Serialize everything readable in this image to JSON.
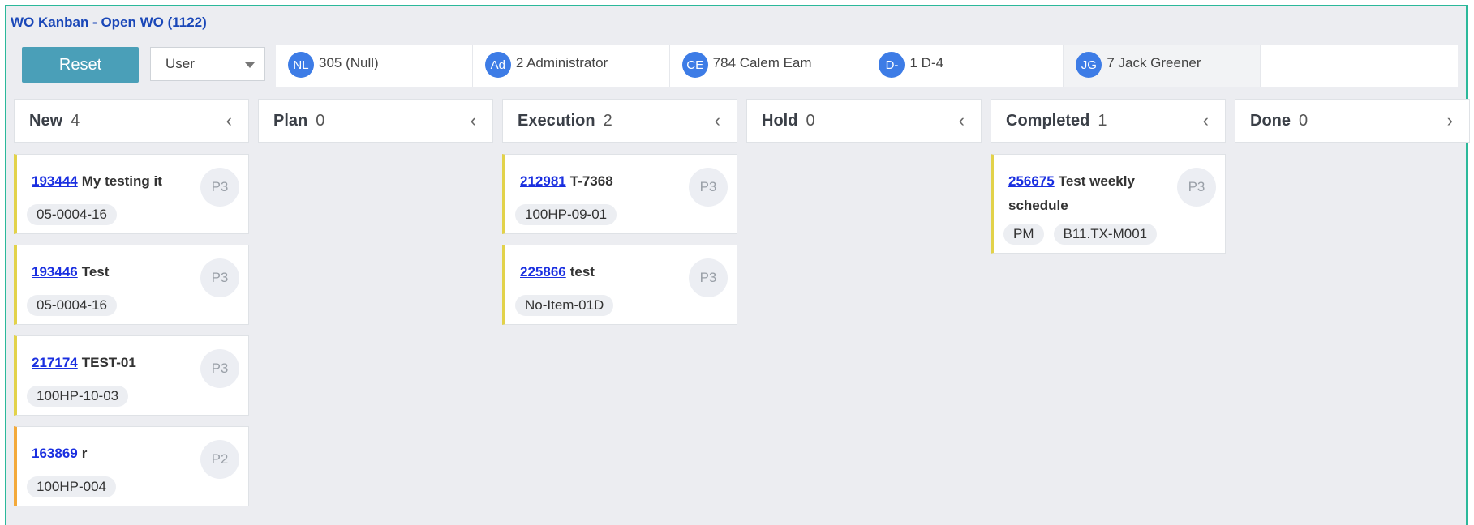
{
  "header": {
    "title": "WO Kanban - Open WO (1122)"
  },
  "toolbar": {
    "reset_label": "Reset",
    "user_select_value": "User"
  },
  "users": [
    {
      "initials": "NL",
      "label": "305 (Null)"
    },
    {
      "initials": "Ad",
      "label": "2 Administrator"
    },
    {
      "initials": "CE",
      "label": "784 Calem Eam"
    },
    {
      "initials": "D-",
      "label": "1 D-4"
    },
    {
      "initials": "JG",
      "label": "7 Jack Greener"
    }
  ],
  "columns": [
    {
      "name": "New",
      "count": "4",
      "chevron": "‹"
    },
    {
      "name": "Plan",
      "count": "0",
      "chevron": "‹"
    },
    {
      "name": "Execution",
      "count": "2",
      "chevron": "‹"
    },
    {
      "name": "Hold",
      "count": "0",
      "chevron": "‹"
    },
    {
      "name": "Completed",
      "count": "1",
      "chevron": "‹"
    },
    {
      "name": "Done",
      "count": "0",
      "chevron": "›"
    }
  ],
  "cards": {
    "new": [
      {
        "wo": "193444",
        "title": "My testing it",
        "priority": "P3",
        "tags": [
          "05-0004-16"
        ]
      },
      {
        "wo": "193446",
        "title": "Test",
        "priority": "P3",
        "tags": [
          "05-0004-16"
        ]
      },
      {
        "wo": "217174",
        "title": "TEST-01",
        "priority": "P3",
        "tags": [
          "100HP-10-03"
        ]
      },
      {
        "wo": "163869",
        "title": "r",
        "priority": "P2",
        "tags": [
          "100HP-004"
        ]
      }
    ],
    "execution": [
      {
        "wo": "212981",
        "title": "T-7368",
        "priority": "P3",
        "tags": [
          "100HP-09-01"
        ]
      },
      {
        "wo": "225866",
        "title": "test",
        "priority": "P3",
        "tags": [
          "No-Item-01D"
        ]
      }
    ],
    "completed": [
      {
        "wo": "256675",
        "title": "Test weekly schedule",
        "priority": "P3",
        "tags": [
          "PM",
          "B11.TX-M001"
        ]
      }
    ]
  },
  "colors": {
    "accent": "#4a9fb8",
    "avatar": "#3d7ce6",
    "p3_stripe": "#e2d24a",
    "p2_stripe": "#f3a93a",
    "link": "#1a2fe0"
  }
}
